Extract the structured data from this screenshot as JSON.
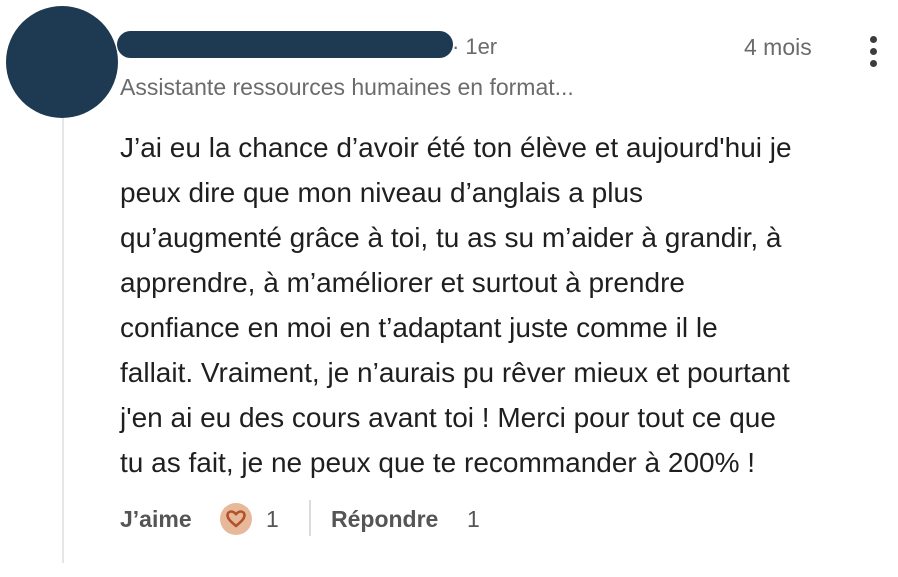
{
  "comment": {
    "connection_degree": "1er",
    "timestamp": "4 mois",
    "author_headline": "Assistante ressources humaines en format...",
    "text_lines": [
      "J’ai eu la chance d’avoir été ton élève et aujourd'hui je",
      "peux dire que mon niveau d’anglais a plus",
      "qu’augmenté grâce à toi, tu as su m’aider à grandir, à",
      "apprendre, à m’améliorer et surtout à prendre",
      "confiance en moi en t’adaptant juste comme il le",
      "fallait. Vraiment, je n’aurais pu rêver mieux et pourtant",
      "j'en ai eu des cours avant toi ! Merci pour tout ce que",
      "tu as fait, je ne peux que te recommander à 200% !"
    ],
    "avatar_color": "#1d3a52",
    "redaction_color": "#1d3a52"
  },
  "actions": {
    "like_label": "J’aime",
    "like_count": "1",
    "reaction_icon": "heart-icon",
    "reaction_color": "#e8b89a",
    "reply_label": "Répondre",
    "reply_count": "1"
  }
}
